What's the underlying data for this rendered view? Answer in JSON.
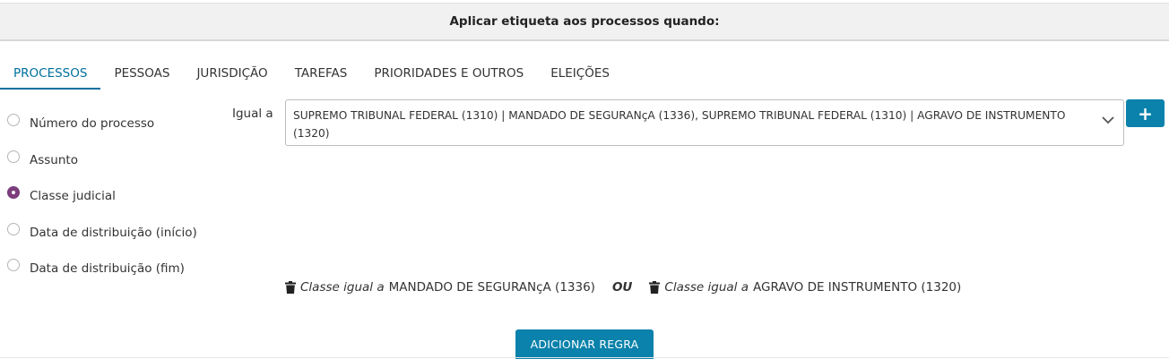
{
  "header": {
    "title": "Aplicar etiqueta aos processos quando:"
  },
  "tabs": [
    {
      "label": "PROCESSOS",
      "active": true
    },
    {
      "label": "PESSOAS",
      "active": false
    },
    {
      "label": "JURISDIÇÃO",
      "active": false
    },
    {
      "label": "TAREFAS",
      "active": false
    },
    {
      "label": "PRIORIDADES E OUTROS",
      "active": false
    },
    {
      "label": "ELEIÇÕES",
      "active": false
    }
  ],
  "fields": [
    {
      "label": "Número do processo",
      "checked": false
    },
    {
      "label": "Assunto",
      "checked": false
    },
    {
      "label": "Classe judicial",
      "checked": true
    },
    {
      "label": "Data de distribuição (início)",
      "checked": false
    },
    {
      "label": "Data de distribuição (fim)",
      "checked": false
    }
  ],
  "condition": {
    "operator_label": "Igual a",
    "selected_value": "SUPREMO TRIBUNAL FEDERAL (1310) | MANDADO DE SEGURANçA (1336), SUPREMO TRIBUNAL FEDERAL (1310) | AGRAVO DE INSTRUMENTO (1320)",
    "add_label": "+"
  },
  "rules": [
    {
      "field": "Classe",
      "operator": "igual a",
      "value": "MANDADO DE SEGURANçA (1336)"
    },
    {
      "field": "Classe",
      "operator": "igual a",
      "value": "AGRAVO DE INSTRUMENTO (1320)"
    }
  ],
  "rules_separator": "OU",
  "actions": {
    "add_rule_label": "ADICIONAR REGRA"
  },
  "colors": {
    "accent": "#00709e",
    "button": "#0a82ab",
    "radio_checked": "#7b3d7b"
  }
}
